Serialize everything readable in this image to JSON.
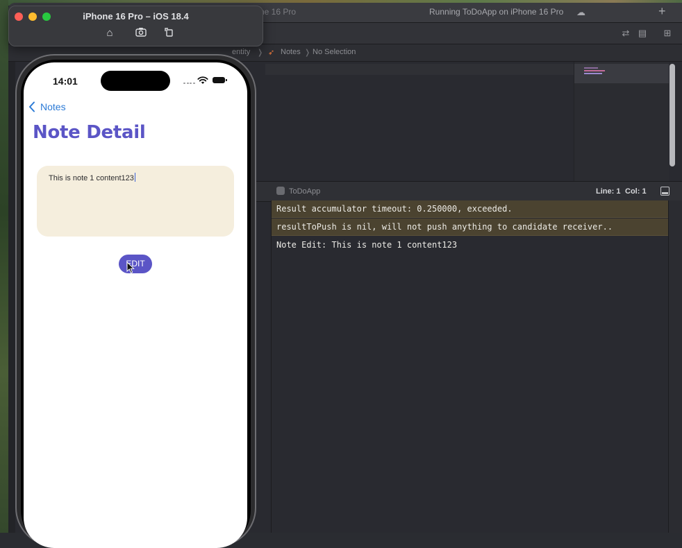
{
  "simulator": {
    "title": "iPhone 16 Pro – iOS 18.4"
  },
  "xcode": {
    "tab_device_fragment": "ne 16 Pro",
    "activity_status": "Running ToDoApp on iPhone 16 Pro",
    "jumpbar": {
      "folder_fragment": "entity",
      "file": "Notes",
      "selection": "No Selection"
    },
    "debug_bar": {
      "target": "ToDoApp",
      "line": "Line: 1",
      "col": "Col: 1"
    },
    "console_lines": [
      {
        "text": "Result accumulator timeout: 0.250000, exceeded.",
        "level": "warning"
      },
      {
        "text": "resultToPush is nil, will not push anything to candidate receiver..",
        "level": "warning"
      },
      {
        "text": "Note Edit: This is note 1 content123",
        "level": "info"
      }
    ]
  },
  "phone": {
    "status_time": "14:01",
    "nav_back_label": "Notes",
    "page_title": "Note Detail",
    "note_content": "This is note 1 content123",
    "edit_button_label": "EDIT"
  },
  "colors": {
    "accent_purple": "#5b55c6",
    "note_background": "#f5eedd",
    "link_blue": "#2b7ad6",
    "console_warning_bg": "#4b4330"
  }
}
